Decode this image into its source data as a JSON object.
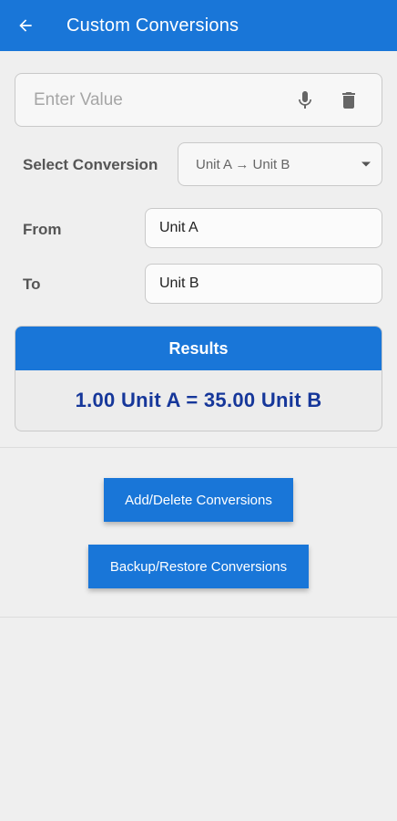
{
  "header": {
    "title": "Custom Conversions",
    "back_icon": "arrow-left-icon",
    "color": "#1976d8"
  },
  "value_input": {
    "placeholder": "Enter Value",
    "value": "",
    "mic_icon": "microphone-icon",
    "delete_icon": "trash-icon"
  },
  "conversion": {
    "label": "Select Conversion",
    "selected": "Unit A → Unit B"
  },
  "from": {
    "label": "From",
    "value": "Unit A"
  },
  "to": {
    "label": "To",
    "value": "Unit B"
  },
  "results": {
    "title": "Results",
    "text": "1.00 Unit A = 35.00 Unit B",
    "text_color": "#16379a"
  },
  "buttons": {
    "add_delete": "Add/Delete Conversions",
    "backup_restore": "Backup/Restore Conversions"
  }
}
